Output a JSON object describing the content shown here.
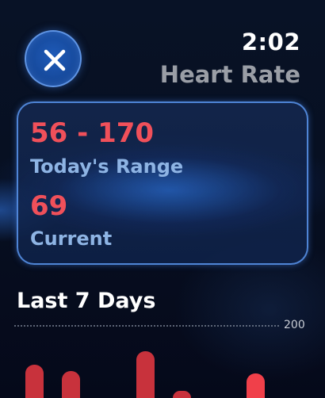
{
  "status": {
    "time": "2:02"
  },
  "header": {
    "title": "Heart Rate",
    "close_icon": "close-icon"
  },
  "range_card": {
    "range_value": "56 - 170",
    "range_label": "Today's Range",
    "current_value": "69",
    "current_label": "Current"
  },
  "history": {
    "title": "Last 7 Days",
    "max_label": "200",
    "chart_data": {
      "type": "bar",
      "ylim": [
        0,
        200
      ],
      "values": [
        170,
        165,
        0,
        180,
        150,
        0,
        163
      ],
      "grid": "dotted max line only"
    }
  },
  "colors": {
    "accent_red": "#f0505a",
    "bar_red": "#c8323c",
    "label_blue": "#8eb4e4",
    "card_border": "#5a96f0"
  }
}
